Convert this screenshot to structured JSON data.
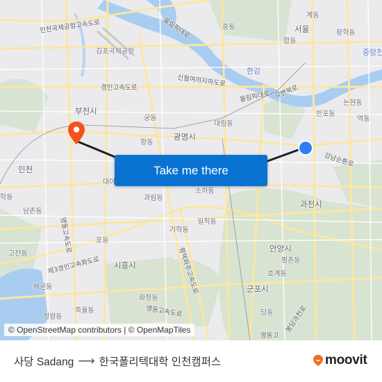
{
  "map": {
    "labels": {
      "incheon_airport_expwy": "인천국제공항고속도로",
      "gimpo_airport": "김포국제공항",
      "olympic_daero_n": "올림픽대로",
      "jungdong": "중동",
      "gyedong": "계동",
      "seoul": "서울",
      "hwanghakdong": "황학동",
      "hapdong": "합동",
      "jungnangcheon": "중랑천",
      "hangang": "한강",
      "gyeongin_expwy": "경인고속도로",
      "sinwol_yeoui_tunnel": "신월여의지하도로",
      "olympic_daero": "올림픽대로",
      "gangbyeon_buk": "강변북로",
      "bucheon": "부천시",
      "gungdong": "궁동",
      "hangdong": "항동",
      "gwangmyeong": "광명시",
      "daerimdong": "대림동",
      "banpodong": "반포동",
      "nonhyeondong": "논현동",
      "yeokdong": "역동",
      "gangnam_sunhwan": "강남순환로",
      "incheon": "인천",
      "hakdong": "학동",
      "daeya": "대야",
      "namchondong": "남촌동",
      "yeongdong_expwy_n": "영동고속도로",
      "gwarimdong": "과림동",
      "sohadong": "소하동",
      "iljikdong": "일직동",
      "gahakdong": "가학동",
      "podong": "포동",
      "gojandong": "고잔동",
      "third_gyeongin": "제3경인고속화도로",
      "siheung": "시흥시",
      "pyeongtaek_paju_expwy": "평택파주고속도로",
      "baegotdong": "배곧동",
      "hwajeongdong": "화정동",
      "yeongdong_expwy": "영동고속도로",
      "jugyuldong": "죽율동",
      "jeongwangdong": "정왕동",
      "gwacheon": "과천시",
      "anyang": "안양시",
      "pyeongchondong": "평촌동",
      "hogyedong": "호계동",
      "gunpo": "군포시",
      "dangdong": "당동",
      "yeongdong_go": "영동고",
      "bongdam_expwy": "봉담과천로"
    },
    "attribution": "© OpenStreetMap contributors | © OpenMapTiles",
    "origin_marker_color": "#2f7cf6",
    "destination_marker_color": "#f4511e",
    "route_line_color": "#1f1f1f"
  },
  "cta": {
    "label": "Take me there",
    "color": "#0a73d2"
  },
  "footer": {
    "origin": "사당 Sadang",
    "arrow": "⟶",
    "destination": "한국폴리텍대학 인천캠퍼스",
    "brand": "moovit",
    "brand_color": "#f26b21"
  }
}
